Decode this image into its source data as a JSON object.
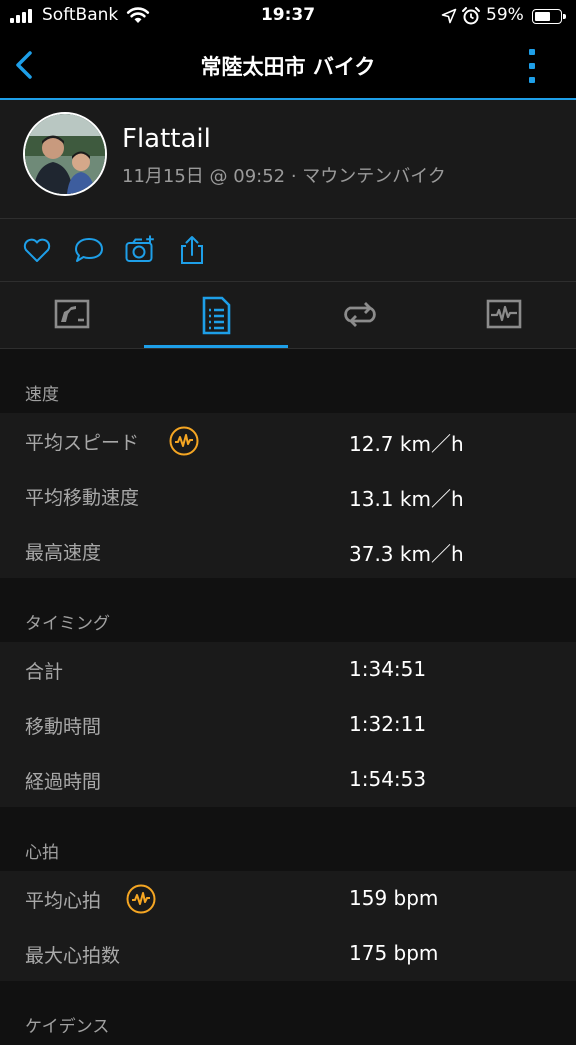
{
  "status_bar": {
    "carrier": "SoftBank",
    "time": "19:37",
    "battery": "59%",
    "battery_level": 0.59
  },
  "nav": {
    "title": "常陸太田市 バイク"
  },
  "profile": {
    "name": "Flattail",
    "meta": "11月15日 @ 09:52 · マウンテンバイク"
  },
  "actions": [
    "heart-icon",
    "comment-icon",
    "add-photo-icon",
    "share-icon"
  ],
  "tabs": {
    "items": [
      "overview-tab",
      "stats-tab",
      "laps-tab",
      "charts-tab"
    ],
    "active": "stats-tab"
  },
  "sections": {
    "speed": {
      "title": "速度",
      "rows": [
        {
          "label": "平均スピード",
          "value": "12.7 km／h"
        },
        {
          "label": "平均移動速度",
          "value": "13.1 km／h"
        },
        {
          "label": "最高速度",
          "value": "37.3 km／h"
        }
      ]
    },
    "timing": {
      "title": "タイミング",
      "rows": [
        {
          "label": "合計",
          "value": "1:34:51"
        },
        {
          "label": "移動時間",
          "value": "1:32:11"
        },
        {
          "label": "経過時間",
          "value": "1:54:53"
        }
      ]
    },
    "heart": {
      "title": "心拍",
      "rows": [
        {
          "label": "平均心拍",
          "value": "159 bpm"
        },
        {
          "label": "最大心拍数",
          "value": "175 bpm"
        }
      ]
    },
    "cadence": {
      "title": "ケイデンス"
    }
  },
  "colors": {
    "accent": "#1e9fe8",
    "badge": "#f5a623",
    "background": "#111111",
    "panel": "#1a1a1a"
  }
}
